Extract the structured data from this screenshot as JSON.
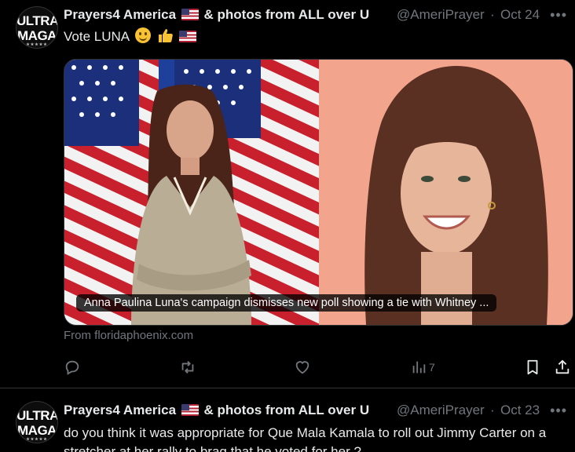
{
  "tweets": [
    {
      "avatar_text": [
        "ULTRA",
        "MAGA"
      ],
      "author_name": "Prayers4 America",
      "author_suffix": "& photos from ALL over U",
      "handle": "@AmeriPrayer",
      "separator": "·",
      "date": "Oct 24",
      "more": "•••",
      "text": "Vote LUNA",
      "card": {
        "caption": "Anna Paulina Luna's campaign dismisses new poll showing a tie with Whitney ...",
        "source": "From floridaphoenix.com"
      },
      "actions": {
        "reply_count": "",
        "retweet_count": "",
        "like_count": "",
        "views_count": "7"
      }
    },
    {
      "avatar_text": [
        "ULTRA",
        "MAGA"
      ],
      "author_name": "Prayers4 America",
      "author_suffix": "& photos from ALL over U",
      "handle": "@AmeriPrayer",
      "separator": "·",
      "date": "Oct 23",
      "more": "•••",
      "text": "do you think it was appropriate for Que Mala Kamala to roll out Jimmy Carter on a stretcher at her rally to brag that he voted for her ?"
    }
  ],
  "colors": {
    "background": "#000000",
    "text_primary": "#e7e9ea",
    "text_secondary": "#71767b",
    "divider": "#2f3336"
  },
  "icons": [
    "reply-icon",
    "retweet-icon",
    "like-icon",
    "views-icon",
    "bookmark-icon",
    "share-icon",
    "more-icon",
    "flag-us-icon",
    "smiley-icon",
    "thumbs-up-icon"
  ]
}
